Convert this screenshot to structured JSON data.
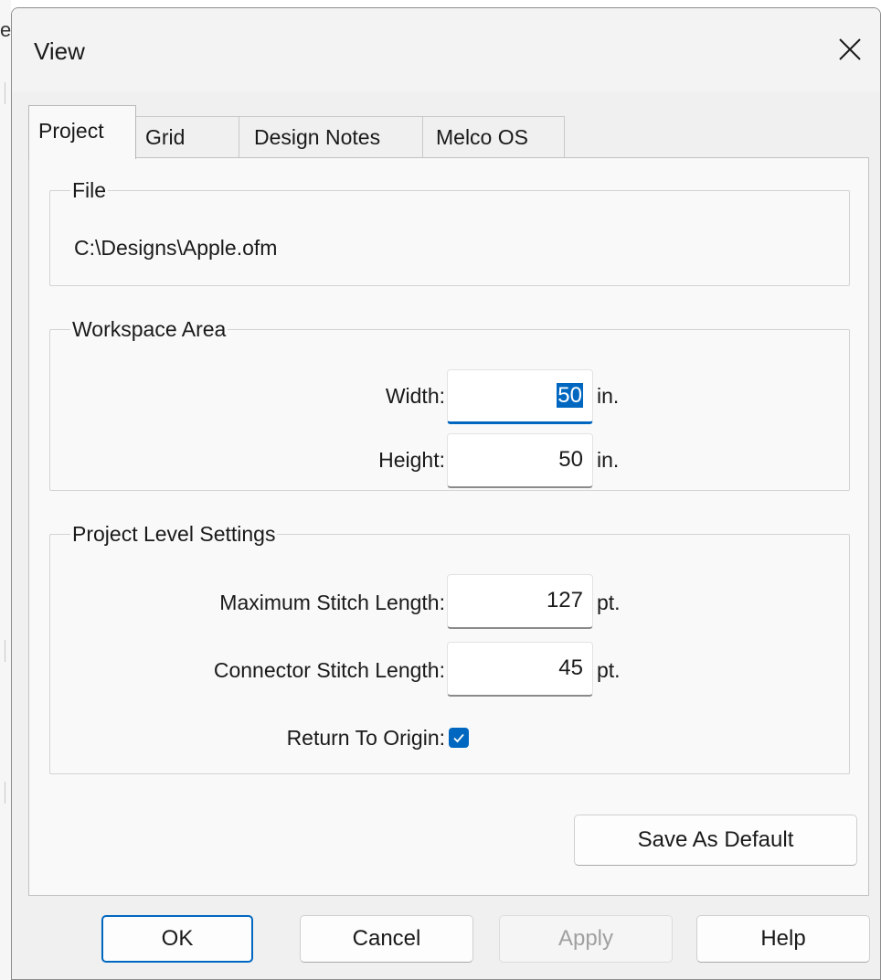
{
  "background": {
    "letter": "e"
  },
  "dialog": {
    "title": "View"
  },
  "tabs": [
    {
      "label": "Project",
      "active": true
    },
    {
      "label": "Grid",
      "active": false
    },
    {
      "label": "Design Notes",
      "active": false
    },
    {
      "label": "Melco OS",
      "active": false
    }
  ],
  "file": {
    "legend": "File",
    "path": "C:\\Designs\\Apple.ofm"
  },
  "workspace": {
    "legend": "Workspace Area",
    "width_label": "Width:",
    "width_value": "50",
    "width_unit": "in.",
    "height_label": "Height:",
    "height_value": "50",
    "height_unit": "in."
  },
  "project_settings": {
    "legend": "Project Level Settings",
    "max_stitch_label": "Maximum Stitch Length:",
    "max_stitch_value": "127",
    "max_stitch_unit": "pt.",
    "connector_label": "Connector Stitch Length:",
    "connector_value": "45",
    "connector_unit": "pt.",
    "return_label": "Return To Origin:",
    "return_checked": true
  },
  "buttons": {
    "save_default": "Save As Default",
    "ok": "OK",
    "cancel": "Cancel",
    "apply": "Apply",
    "help": "Help"
  },
  "colors": {
    "accent": "#0067c0",
    "dialog_bg": "#f0f0f0",
    "panel_bg": "#f9f9f9"
  },
  "icons": {
    "close": "close-icon",
    "check": "checkmark-icon"
  }
}
